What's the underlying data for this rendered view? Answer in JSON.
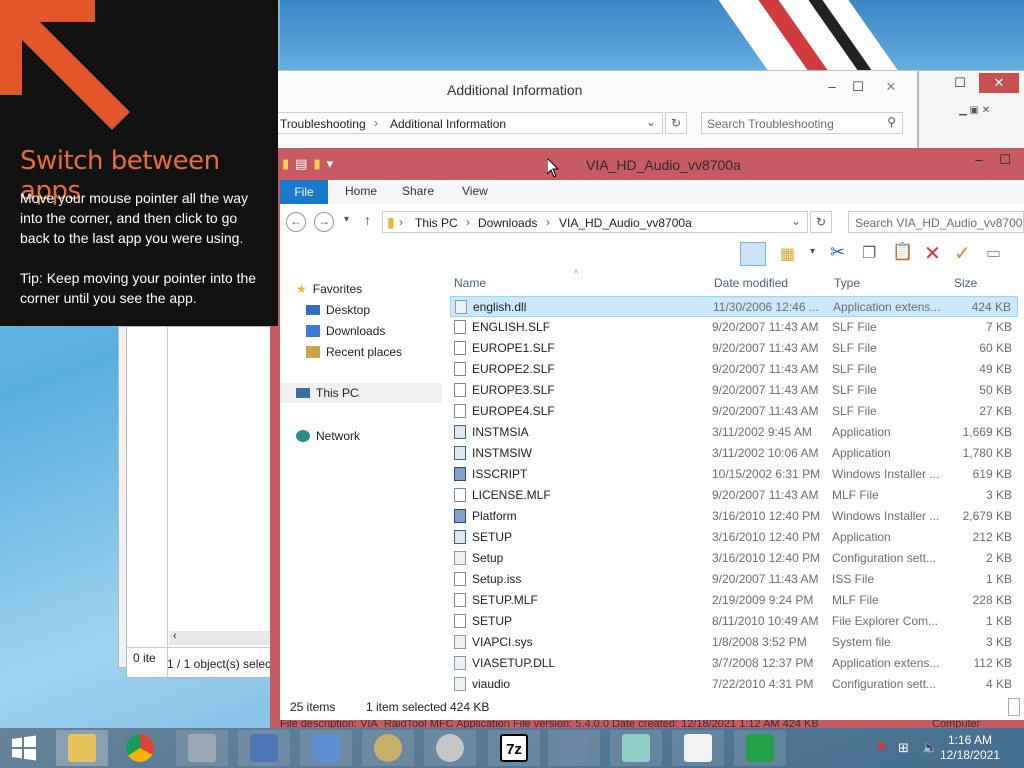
{
  "charm": {
    "title": "Switch between apps",
    "text1": "Move your mouse pointer all the way into the corner, and then click to go back to the last app you were using.",
    "text2": "Tip: Keep moving your pointer into the corner until you see the app."
  },
  "addinfo": {
    "title": "Additional Information",
    "breadcrumb": [
      "Troubleshooting",
      "Additional Information"
    ],
    "search_placeholder": "Search Troubleshooting"
  },
  "behind_window": {
    "status_left": "0 ite",
    "status_right": "1 / 1 object(s) selec"
  },
  "explorer": {
    "title": "VIA_HD_Audio_vv8700a",
    "tabs": [
      "File",
      "Home",
      "Share",
      "View"
    ],
    "breadcrumb": [
      "This PC",
      "Downloads",
      "VIA_HD_Audio_vv8700a"
    ],
    "search_placeholder": "Search VIA_HD_Audio_vv8700a",
    "nav": {
      "favorites": "Favorites",
      "desktop": "Desktop",
      "downloads": "Downloads",
      "recent": "Recent places",
      "thispc": "This PC",
      "network": "Network"
    },
    "columns": {
      "name": "Name",
      "date": "Date modified",
      "type": "Type",
      "size": "Size"
    },
    "files": [
      {
        "name": "english.dll",
        "date": "11/30/2006 12:46 ...",
        "type": "Application extens...",
        "size": "424 KB",
        "icon": "cfg",
        "selected": true
      },
      {
        "name": "ENGLISH.SLF",
        "date": "9/20/2007 11:43 AM",
        "type": "SLF File",
        "size": "7 KB",
        "icon": "file"
      },
      {
        "name": "EUROPE1.SLF",
        "date": "9/20/2007 11:43 AM",
        "type": "SLF File",
        "size": "60 KB",
        "icon": "file"
      },
      {
        "name": "EUROPE2.SLF",
        "date": "9/20/2007 11:43 AM",
        "type": "SLF File",
        "size": "49 KB",
        "icon": "file"
      },
      {
        "name": "EUROPE3.SLF",
        "date": "9/20/2007 11:43 AM",
        "type": "SLF File",
        "size": "50 KB",
        "icon": "file"
      },
      {
        "name": "EUROPE4.SLF",
        "date": "9/20/2007 11:43 AM",
        "type": "SLF File",
        "size": "27 KB",
        "icon": "file"
      },
      {
        "name": "INSTMSIA",
        "date": "3/11/2002 9:45 AM",
        "type": "Application",
        "size": "1,669 KB",
        "icon": "app"
      },
      {
        "name": "INSTMSIW",
        "date": "3/11/2002 10:06 AM",
        "type": "Application",
        "size": "1,780 KB",
        "icon": "app"
      },
      {
        "name": "ISSCRIPT",
        "date": "10/15/2002 6:31 PM",
        "type": "Windows Installer ...",
        "size": "619 KB",
        "icon": "inst"
      },
      {
        "name": "LICENSE.MLF",
        "date": "9/20/2007 11:43 AM",
        "type": "MLF File",
        "size": "3 KB",
        "icon": "file"
      },
      {
        "name": "Platform",
        "date": "3/16/2010 12:40 PM",
        "type": "Windows Installer ...",
        "size": "2,679 KB",
        "icon": "inst"
      },
      {
        "name": "SETUP",
        "date": "3/16/2010 12:40 PM",
        "type": "Application",
        "size": "212 KB",
        "icon": "app"
      },
      {
        "name": "Setup",
        "date": "3/16/2010 12:40 PM",
        "type": "Configuration sett...",
        "size": "2 KB",
        "icon": "cfg"
      },
      {
        "name": "Setup.iss",
        "date": "9/20/2007 11:43 AM",
        "type": "ISS File",
        "size": "1 KB",
        "icon": "file"
      },
      {
        "name": "SETUP.MLF",
        "date": "2/19/2009 9:24 PM",
        "type": "MLF File",
        "size": "228 KB",
        "icon": "file"
      },
      {
        "name": "SETUP",
        "date": "8/11/2010 10:49 AM",
        "type": "File Explorer Com...",
        "size": "1 KB",
        "icon": "file"
      },
      {
        "name": "VIAPCI.sys",
        "date": "1/8/2008 3:52 PM",
        "type": "System file",
        "size": "3 KB",
        "icon": "cfg"
      },
      {
        "name": "VIASETUP.DLL",
        "date": "3/7/2008 12:37 PM",
        "type": "Application extens...",
        "size": "112 KB",
        "icon": "cfg"
      },
      {
        "name": "viaudio",
        "date": "7/22/2010 4:31 PM",
        "type": "Configuration sett...",
        "size": "4 KB",
        "icon": "cfg"
      }
    ],
    "status": {
      "items": "25 items",
      "selected": "1 item selected",
      "size": "424 KB"
    },
    "file_desc": "File description: VIA_RaidTool MFC Application  File version: 5.4.0.0  Date created: 12/18/2021 1:12 AM  424 KB",
    "computer_label": "Computer"
  },
  "taskbar": {
    "time": "1:16 AM",
    "date": "12/18/2021",
    "zip_label": "7z"
  }
}
